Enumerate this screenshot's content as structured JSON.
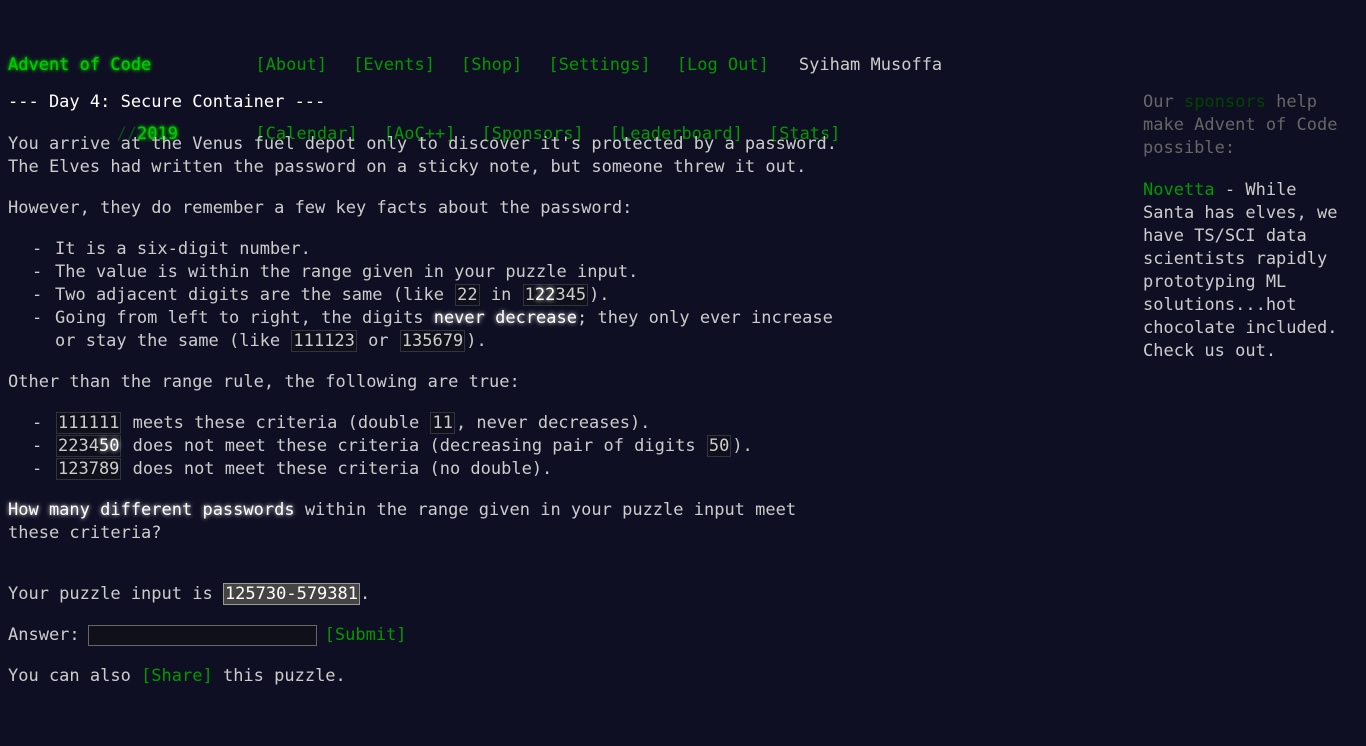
{
  "header": {
    "logo": "Advent of Code",
    "year_prefix": "//",
    "year": "2019",
    "nav_top": [
      "[About]",
      "[Events]",
      "[Shop]",
      "[Settings]",
      "[Log Out]"
    ],
    "user": "Syiham Musoffa",
    "nav_bottom": [
      "[Calendar]",
      "[AoC++]",
      "[Sponsors]",
      "[Leaderboard]",
      "[Stats]"
    ]
  },
  "article": {
    "title": "--- Day 4: Secure Container ---",
    "intro": "You arrive at the Venus fuel depot only to discover it's protected by a password. The Elves had written the password on a sticky note, but someone threw it out.",
    "remember": "However, they do remember a few key facts about the password:",
    "facts": {
      "f1": "It is a six-digit number.",
      "f2": "The value is within the range given in your puzzle input.",
      "f3_a": "Two adjacent digits are the same (like ",
      "f3_code1": "22",
      "f3_b": " in ",
      "f3_code2_dim": "1",
      "f3_code2_hl": "22",
      "f3_code2_tail": "345",
      "f3_c": ").",
      "f4_a": "Going from left to right, the digits ",
      "f4_em": "never decrease",
      "f4_b": "; they only ever increase or stay the same (like ",
      "f4_code1": "111123",
      "f4_c": " or ",
      "f4_code2": "135679",
      "f4_d": ")."
    },
    "other": "Other than the range rule, the following are true:",
    "examples": {
      "e1_code": "111111",
      "e1_a": " meets these criteria (double ",
      "e1_code2": "11",
      "e1_b": ", never decreases).",
      "e2_code_a": "2234",
      "e2_code_b": "50",
      "e2_a": " does not meet these criteria (decreasing pair of digits ",
      "e2_code2": "50",
      "e2_b": ").",
      "e3_code": "123789",
      "e3_a": " does not meet these criteria (no double)."
    },
    "question_em": "How many different passwords",
    "question_rest": " within the range given in your puzzle input meet these criteria?"
  },
  "input": {
    "label": "Your puzzle input is ",
    "value": "125730-579381",
    "suffix": "."
  },
  "answer": {
    "label": "Answer:",
    "value": "",
    "submit": "[Submit]"
  },
  "share": {
    "prefix": "You can also ",
    "link": "[Share]",
    "suffix": " this puzzle."
  },
  "sidebar": {
    "intro_a": "Our ",
    "intro_link": "sponsors",
    "intro_b": " help make Advent of Code possible:",
    "sponsor_name": "Novetta",
    "sponsor_text": " - While Santa has elves, we have TS/SCI data scientists rapidly prototyping ML solutions...hot chocolate included. Check us out."
  }
}
